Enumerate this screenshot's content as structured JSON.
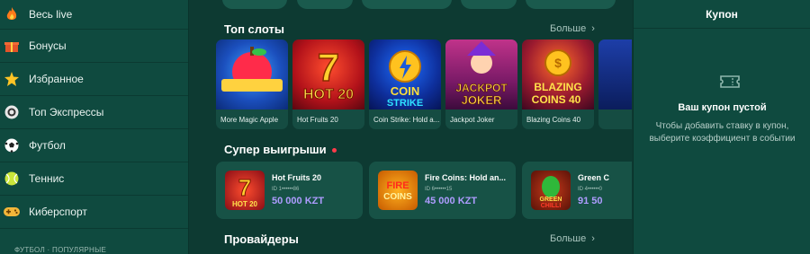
{
  "sidebar": {
    "items": [
      {
        "label": "Весь live",
        "icon": "fire-icon"
      },
      {
        "label": "Бонусы",
        "icon": "gift-icon"
      },
      {
        "label": "Избранное",
        "icon": "star-icon"
      },
      {
        "label": "Топ Экспрессы",
        "icon": "chip-icon"
      },
      {
        "label": "Футбол",
        "icon": "football-icon"
      },
      {
        "label": "Теннис",
        "icon": "tennis-icon"
      },
      {
        "label": "Киберспорт",
        "icon": "gamepad-icon"
      }
    ],
    "footer": "ФУТБОЛ · ПОПУЛЯРНЫЕ"
  },
  "main": {
    "top_slots": {
      "title": "Топ слоты",
      "more": "Больше",
      "items": [
        {
          "caption": "More Magic Apple",
          "art": "More MAGIC APPLE"
        },
        {
          "caption": "Hot Fruits 20",
          "art": "HOT FRUITS 20"
        },
        {
          "caption": "Coin Strike: Hold a...",
          "art": "COIN STRIKE"
        },
        {
          "caption": "Jackpot Joker",
          "art": "JACKPOT JOKER"
        },
        {
          "caption": "Blazing Coins 40",
          "art": "BLAZING COINS 40"
        }
      ]
    },
    "super_wins": {
      "title": "Супер выигрыши",
      "items": [
        {
          "name": "Hot Fruits 20",
          "id": "ID 1••••••86",
          "amount": "50 000 KZT",
          "art": "HOT FRUITS 20"
        },
        {
          "name": "Fire Coins: Hold an...",
          "id": "ID 6••••••15",
          "amount": "45 000 KZT",
          "art": "FIRE COINS"
        },
        {
          "name": "Green C",
          "id": "ID 4••••••0",
          "amount": "91 50",
          "art": "GREEN CHILLI"
        }
      ]
    },
    "providers": {
      "title": "Провайдеры",
      "more": "Больше"
    }
  },
  "coupon": {
    "title": "Купон",
    "empty_title": "Ваш купон пустой",
    "empty_text_1": "Чтобы добавить ставку в купон,",
    "empty_text_2": "выберите коэффициент в событии"
  },
  "colors": {
    "background": "#0d3a32",
    "sidebar": "#0f4a3f",
    "amount": "#ae9cff",
    "live_dot": "#ff3b4a"
  }
}
